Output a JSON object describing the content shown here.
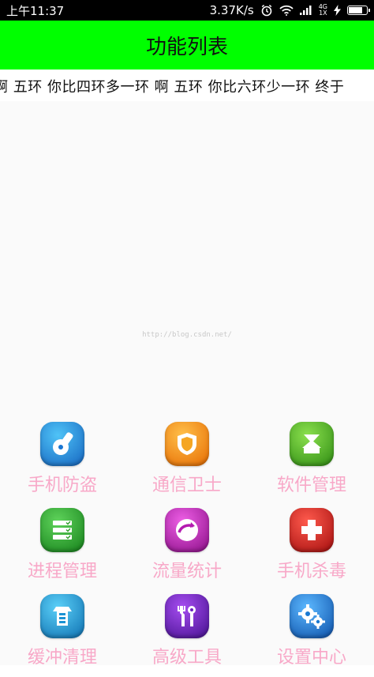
{
  "status_bar": {
    "time": "上午11:37",
    "speed": "3.37K/s",
    "network_top": "4G",
    "network_bottom": "1X"
  },
  "title": "功能列表",
  "marquee": "啊  五环  你比四环多一环   啊  五环  你比六环少一环  终于",
  "watermark": "http://blog.csdn.net/",
  "grid": {
    "items": [
      {
        "label": "手机防盗",
        "icon": "phone-guard-icon",
        "color": "#1e8fd8"
      },
      {
        "label": "通信卫士",
        "icon": "shield-icon",
        "color": "#f08a12"
      },
      {
        "label": "软件管理",
        "icon": "download-icon",
        "color": "#3fa41c"
      },
      {
        "label": "进程管理",
        "icon": "process-list-icon",
        "color": "#2e9e2a"
      },
      {
        "label": "流量统计",
        "icon": "traffic-stats-icon",
        "color": "#b41ab0"
      },
      {
        "label": "手机杀毒",
        "icon": "antivirus-cross-icon",
        "color": "#d01a1a"
      },
      {
        "label": "缓冲清理",
        "icon": "cache-clean-icon",
        "color": "#1b93d4"
      },
      {
        "label": "高级工具",
        "icon": "tools-icon",
        "color": "#6a1fc2"
      },
      {
        "label": "设置中心",
        "icon": "gear-icon",
        "color": "#1a79d2"
      }
    ]
  }
}
